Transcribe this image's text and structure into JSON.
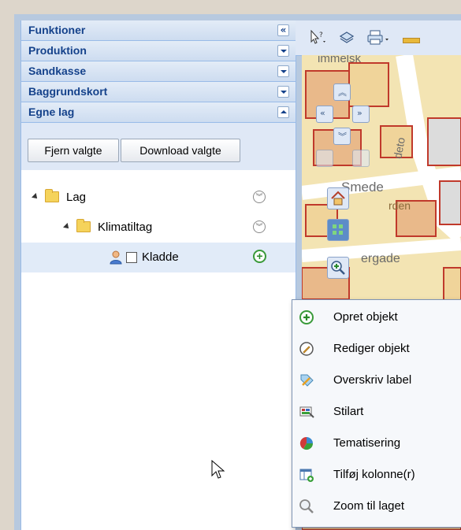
{
  "sidebar": {
    "sections": [
      {
        "label": "Funktioner",
        "state": "collapse-left"
      },
      {
        "label": "Produktion",
        "state": "expand"
      },
      {
        "label": "Sandkasse",
        "state": "expand"
      },
      {
        "label": "Baggrundskort",
        "state": "expand"
      },
      {
        "label": "Egne lag",
        "state": "expanded"
      }
    ],
    "toolbar": {
      "remove_selected": "Fjern valgte",
      "download_selected": "Download valgte"
    },
    "tree": [
      {
        "label": "Lag",
        "level": 0
      },
      {
        "label": "Klimatiltag",
        "level": 1
      },
      {
        "label": "Kladde",
        "level": 2,
        "checked": false
      }
    ]
  },
  "context_menu": {
    "items": [
      {
        "label": "Opret objekt",
        "icon": "add-circle-icon"
      },
      {
        "label": "Rediger objekt",
        "icon": "edit-pencil-icon"
      },
      {
        "label": "Overskriv label",
        "icon": "label-tag-icon"
      },
      {
        "label": "Stilart",
        "icon": "style-icon"
      },
      {
        "label": "Tematisering",
        "icon": "pie-chart-icon"
      },
      {
        "label": "Tilføj kolonne(r)",
        "icon": "add-column-icon"
      },
      {
        "label": "Zoom til laget",
        "icon": "zoom-magnifier-icon"
      }
    ]
  },
  "map": {
    "street_labels": [
      "Smede",
      "ergade",
      "immelsk",
      "deto",
      "rden"
    ]
  },
  "colors": {
    "header_text": "#15428b",
    "panel_bg": "#dfe8f6",
    "map_bg": "#f2e3b0",
    "building_red": "#c0392b"
  }
}
